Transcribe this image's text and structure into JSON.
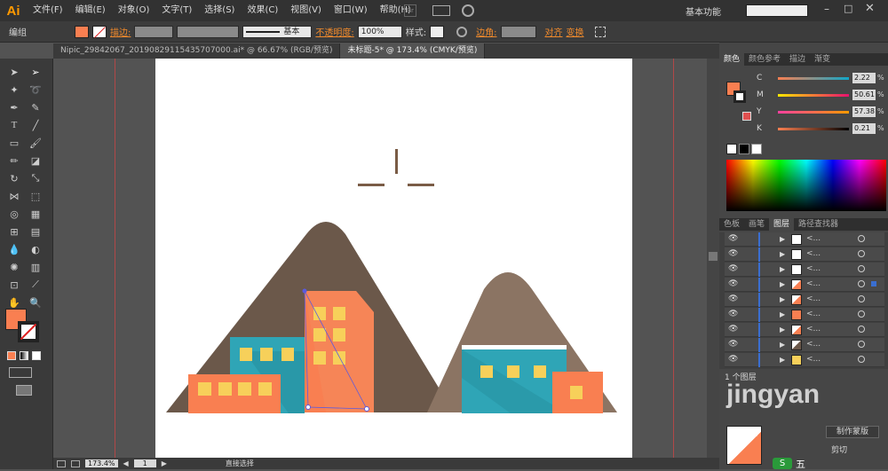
{
  "app": {
    "logo": "Ai"
  },
  "menu": [
    "文件(F)",
    "编辑(E)",
    "对象(O)",
    "文字(T)",
    "选择(S)",
    "效果(C)",
    "视图(V)",
    "窗口(W)",
    "帮助(H)"
  ],
  "workspace": {
    "label": "基本功能",
    "br": "Br"
  },
  "options": {
    "mode_label": "编组",
    "stroke_label": "描边:",
    "stroke_style": "基本",
    "opacity_label": "不透明度:",
    "opacity_value": "100%",
    "style_label": "样式:",
    "corner_label": "边角:",
    "align_label": "对齐",
    "transform_label": "变换"
  },
  "tabs": [
    {
      "label": "Nipic_29842067_20190829115435707000.ai* @ 66.67% (RGB/预览)",
      "active": false
    },
    {
      "label": "未标题-5* @ 173.4% (CMYK/预览)",
      "active": true
    }
  ],
  "status": {
    "zoom": "173.4%",
    "page": "1",
    "tool": "直接选择"
  },
  "panels": {
    "top_tabs": [
      "颜色",
      "颜色参考",
      "描边",
      "渐变"
    ],
    "cmyk": [
      {
        "channel": "C",
        "value": "2.22",
        "unit": "%"
      },
      {
        "channel": "M",
        "value": "50.61",
        "unit": "%"
      },
      {
        "channel": "Y",
        "value": "57.38",
        "unit": "%"
      },
      {
        "channel": "K",
        "value": "0.21",
        "unit": "%"
      }
    ],
    "mid_tabs": [
      "色板",
      "画笔",
      "图层",
      "路径查找器"
    ],
    "layer_name": "<...",
    "layer_count": "1 个图层",
    "bottom": {
      "mask_button": "制作蒙版",
      "clip_label": "剪切"
    }
  },
  "colors": {
    "fill": "#f97f51",
    "mountain_dark": "#6b584a",
    "mountain_light": "#8b7463",
    "building_orange": "#f97f51",
    "building_teal": "#2fa5b6",
    "window": "#f7d05a",
    "sun": "#7a5c46"
  },
  "watermark": {
    "text": "jingyan",
    "taskbar_text": "五"
  }
}
